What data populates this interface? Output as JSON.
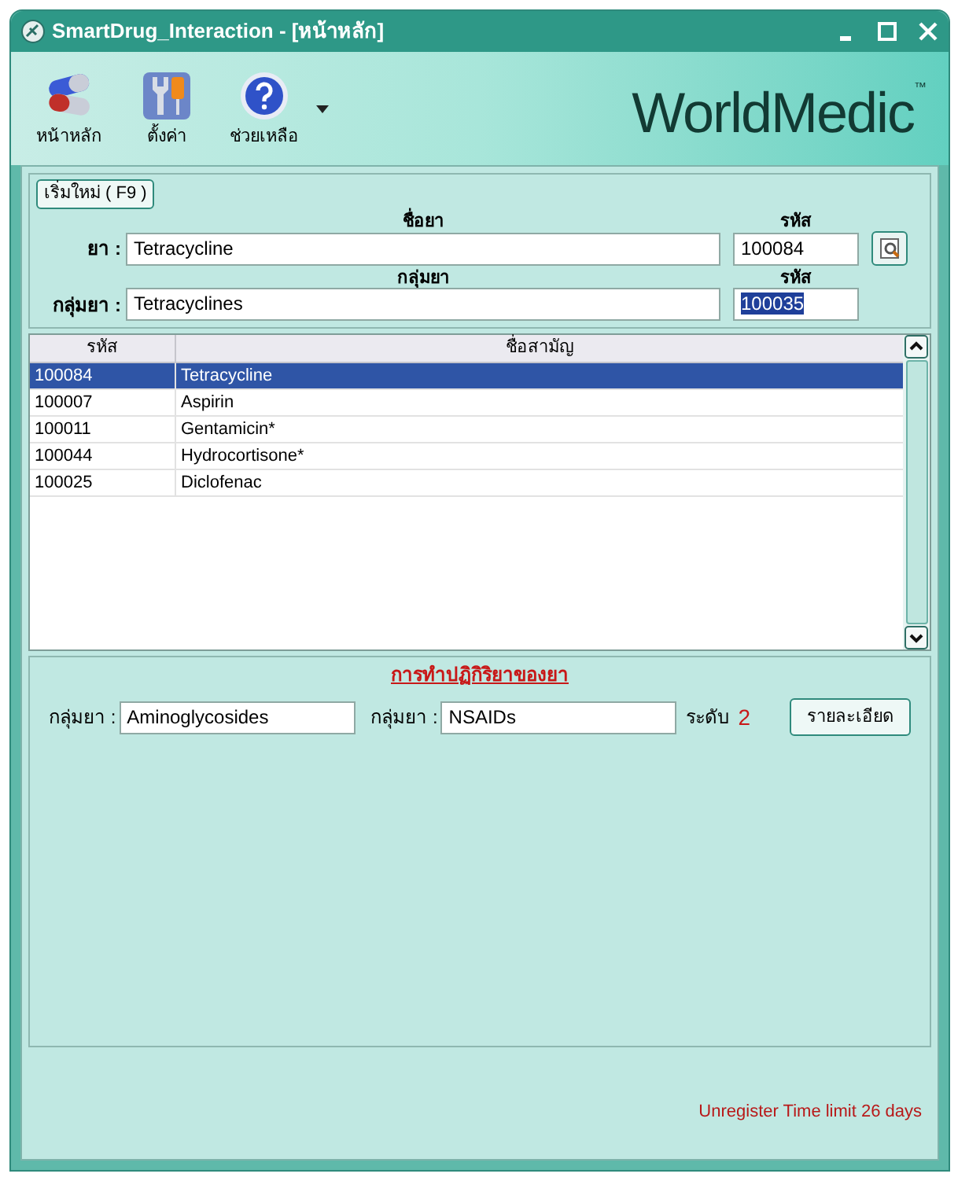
{
  "window": {
    "title": "SmartDrug_Interaction - [หน้าหลัก]"
  },
  "toolbar": [
    {
      "label": "หน้าหลัก",
      "kind": "capsule"
    },
    {
      "label": "ตั้งค่า",
      "kind": "tools"
    },
    {
      "label": "ช่วยเหลือ",
      "kind": "help"
    }
  ],
  "logo": {
    "text": "WorldMedic",
    "mark": "™"
  },
  "search_panel": {
    "new_button": "เริ่มใหม่ ( F9 )",
    "drug_name_header": "ชื่อยา",
    "drug_code_header": "รหัส",
    "drug_label": "ยา :",
    "drug_name": "Tetracycline",
    "drug_code": "100084",
    "group_name_header": "กลุ่มยา",
    "group_code_header": "รหัส",
    "group_label": "กลุ่มยา :",
    "group_name": "Tetracyclines",
    "group_code": "100035",
    "group_code_highlighted": true
  },
  "table": {
    "columns": [
      "รหัส",
      "ชื่อสามัญ"
    ],
    "rows": [
      {
        "code": "100084",
        "name": "Tetracycline",
        "selected": true
      },
      {
        "code": "100007",
        "name": "Aspirin",
        "selected": false
      },
      {
        "code": "100011",
        "name": "Gentamicin*",
        "selected": false
      },
      {
        "code": "100044",
        "name": "Hydrocortisone*",
        "selected": false
      },
      {
        "code": "100025",
        "name": "Diclofenac",
        "selected": false
      }
    ]
  },
  "interaction": {
    "title": "การทำปฏิกิริยาของยา",
    "group1_label": "กลุ่มยา :",
    "group1": "Aminoglycosides",
    "group2_label": "กลุ่มยา :",
    "group2": "NSAIDs",
    "level_label": "ระดับ",
    "level_value": "2",
    "details_button": "รายละเอียด"
  },
  "status": "Unregister Time limit 26 days"
}
